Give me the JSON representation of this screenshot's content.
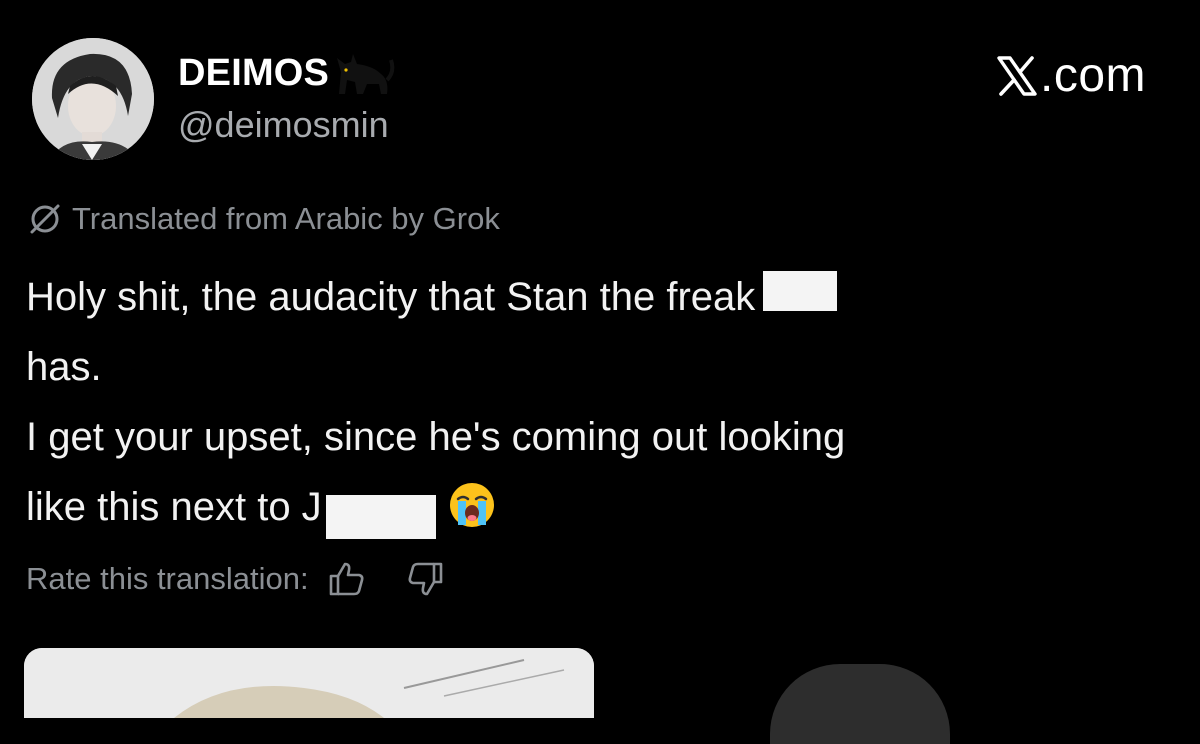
{
  "author": {
    "display_name": "DEIMOS",
    "name_emoji": "cat-icon",
    "handle": "@deimosmin",
    "avatar": "avatar-photo"
  },
  "brand": {
    "logo_icon": "x-logo-icon",
    "suffix": ".com"
  },
  "translation": {
    "icon": "globe-off-icon",
    "label": "Translated from Arabic by Grok"
  },
  "tweet": {
    "line1": "Holy shit, the audacity that Stan the freak",
    "line2": "has.",
    "line3": "I get your upset, since he's coming out looking",
    "line4": "like this next to J",
    "line4_emoji": "loudly-crying-face-icon"
  },
  "rate": {
    "label": "Rate this translation:",
    "up_icon": "thumbs-up-icon",
    "down_icon": "thumbs-down-icon"
  },
  "colors": {
    "background": "#000000",
    "primary_text": "#f2f2f2",
    "secondary_text": "#8b8f94",
    "handle_text": "#a8abaf"
  }
}
